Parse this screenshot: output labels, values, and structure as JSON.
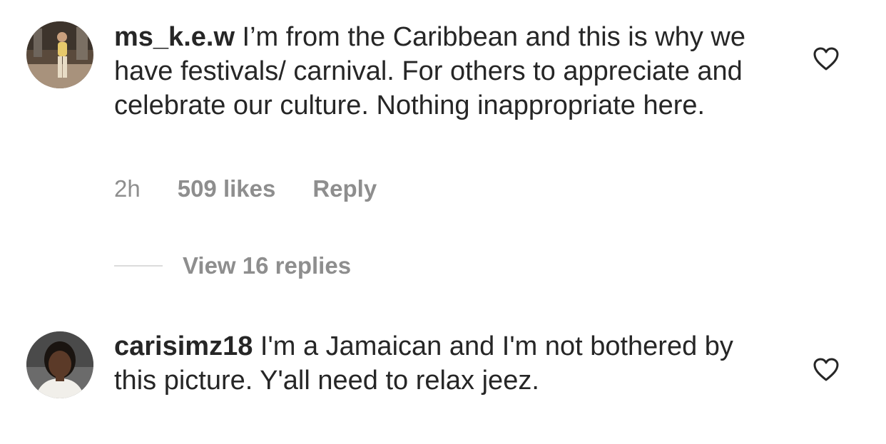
{
  "comments": [
    {
      "username": "ms_k.e.w",
      "text": " I’m from the Caribbean and this is why we have festivals/ carnival. For others to appreciate and celebrate our culture. Nothing inappropriate here.",
      "time": "2h",
      "likes": "509 likes",
      "reply_label": "Reply",
      "view_replies": "View 16 replies",
      "liked": false
    },
    {
      "username": "carisimz18",
      "text": " I'm a Jamaican and I'm not bothered by this picture. Y'all need to relax jeez.",
      "liked": false
    }
  ],
  "colors": {
    "text": "#262626",
    "muted": "#8e8e8e",
    "divider": "#dbdbdb"
  },
  "icons": {
    "like": "heart-outline-icon"
  }
}
